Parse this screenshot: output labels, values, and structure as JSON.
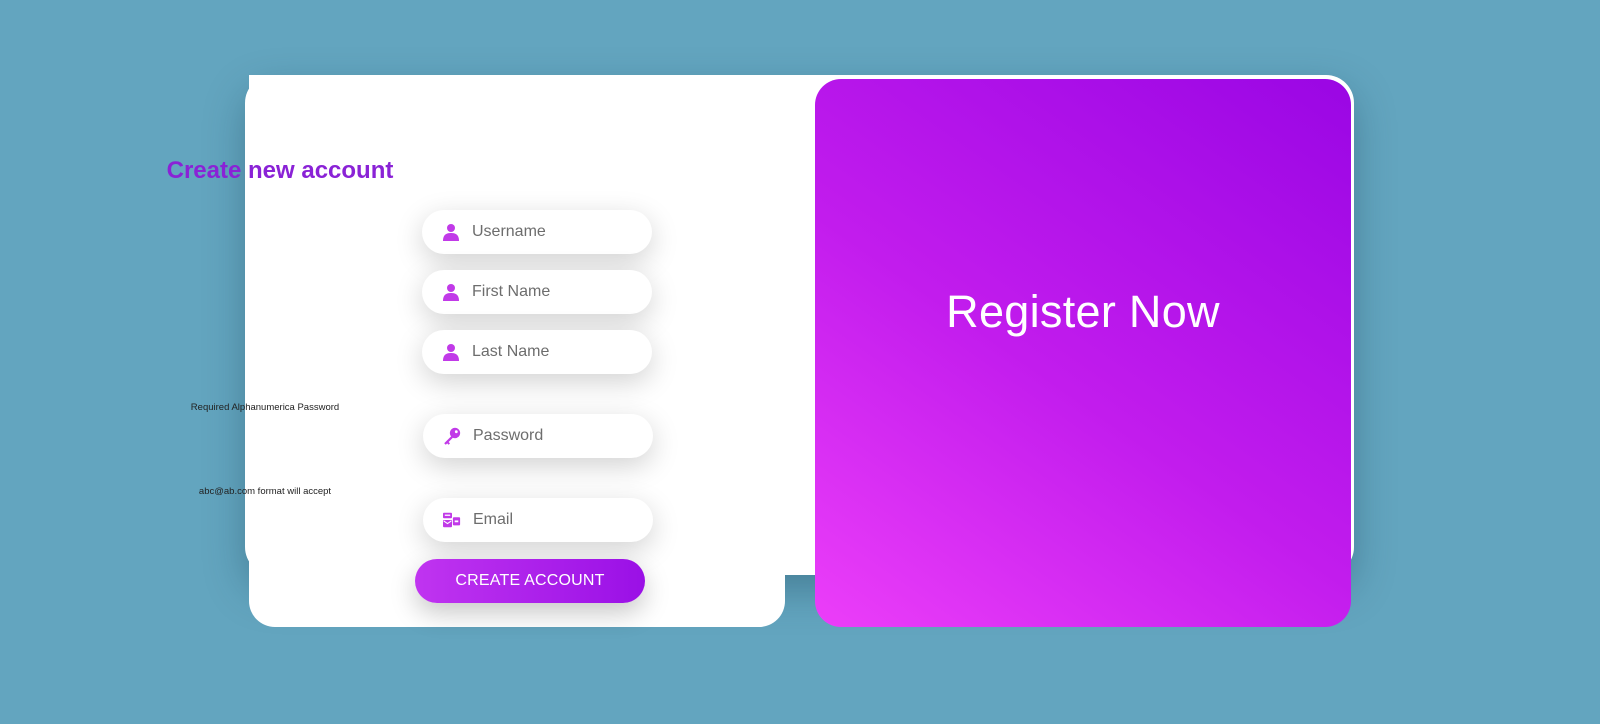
{
  "form": {
    "title": "Create new account",
    "fields": {
      "username": {
        "placeholder": "Username",
        "icon": "user-icon"
      },
      "first_name": {
        "placeholder": "First Name",
        "icon": "user-icon"
      },
      "last_name": {
        "placeholder": "Last Name",
        "icon": "user-icon"
      },
      "password": {
        "placeholder": "Password",
        "icon": "key-icon",
        "hint": "Required Alphanumerica Password"
      },
      "email": {
        "placeholder": "Email",
        "icon": "mail-bulk-icon",
        "hint": "abc@ab.com format will accept"
      }
    },
    "submit_label": "CREATE ACCOUNT"
  },
  "hero": {
    "title": "Register Now"
  },
  "colors": {
    "background": "#63a5bf",
    "accent": "#8a22d6",
    "icon": "#c13ae8",
    "gradient_start": "#ec3ef9",
    "gradient_end": "#9a06e4"
  }
}
